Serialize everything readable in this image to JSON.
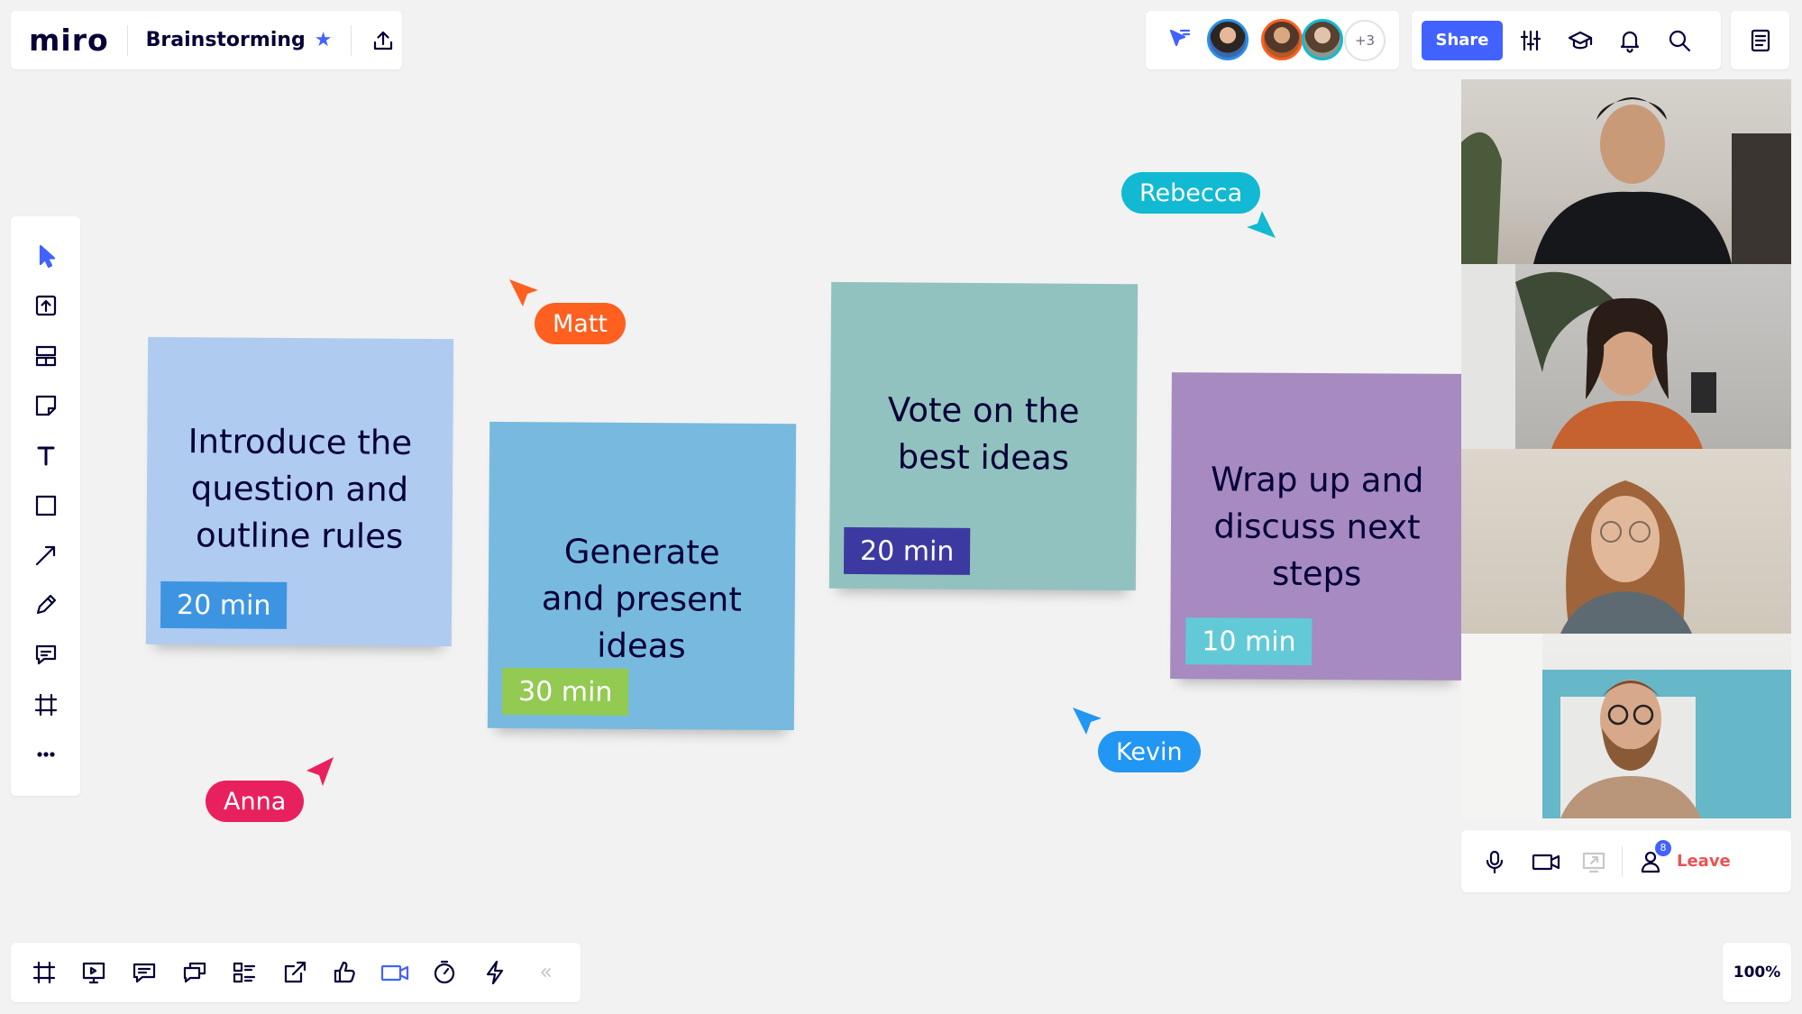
{
  "app": {
    "logo": "miro"
  },
  "board": {
    "title": "Brainstorming"
  },
  "collaborators": {
    "overflow": "+3"
  },
  "header": {
    "share_label": "Share"
  },
  "stickies": [
    {
      "text": "Introduce the question and outline rules",
      "time": "20 min",
      "bg": "#afcbf0",
      "tag_bg": "#3d95e2"
    },
    {
      "text": "Generate and present ideas",
      "time": "30 min",
      "bg": "#78badf",
      "tag_bg": "#93ca52"
    },
    {
      "text": "Vote on the best ideas",
      "time": "20 min",
      "bg": "#92c2bf",
      "tag_bg": "#3c3aa0"
    },
    {
      "text": "Wrap up and discuss next steps",
      "time": "10 min",
      "bg": "#a68ac0",
      "tag_bg": "#61cad6"
    }
  ],
  "cursors": {
    "matt": {
      "name": "Matt",
      "color": "#ff5f1f"
    },
    "rebecca": {
      "name": "Rebecca",
      "color": "#12b9d2"
    },
    "kevin": {
      "name": "Kevin",
      "color": "#2196f3"
    },
    "anna": {
      "name": "Anna",
      "color": "#e8205e"
    }
  },
  "video_panel": {
    "participant_badge": "8",
    "leave_label": "Leave"
  },
  "zoom": {
    "level": "100%"
  },
  "colors": {
    "accent": "#4262ff",
    "leave": "#ec5252",
    "ink": "#050038"
  }
}
